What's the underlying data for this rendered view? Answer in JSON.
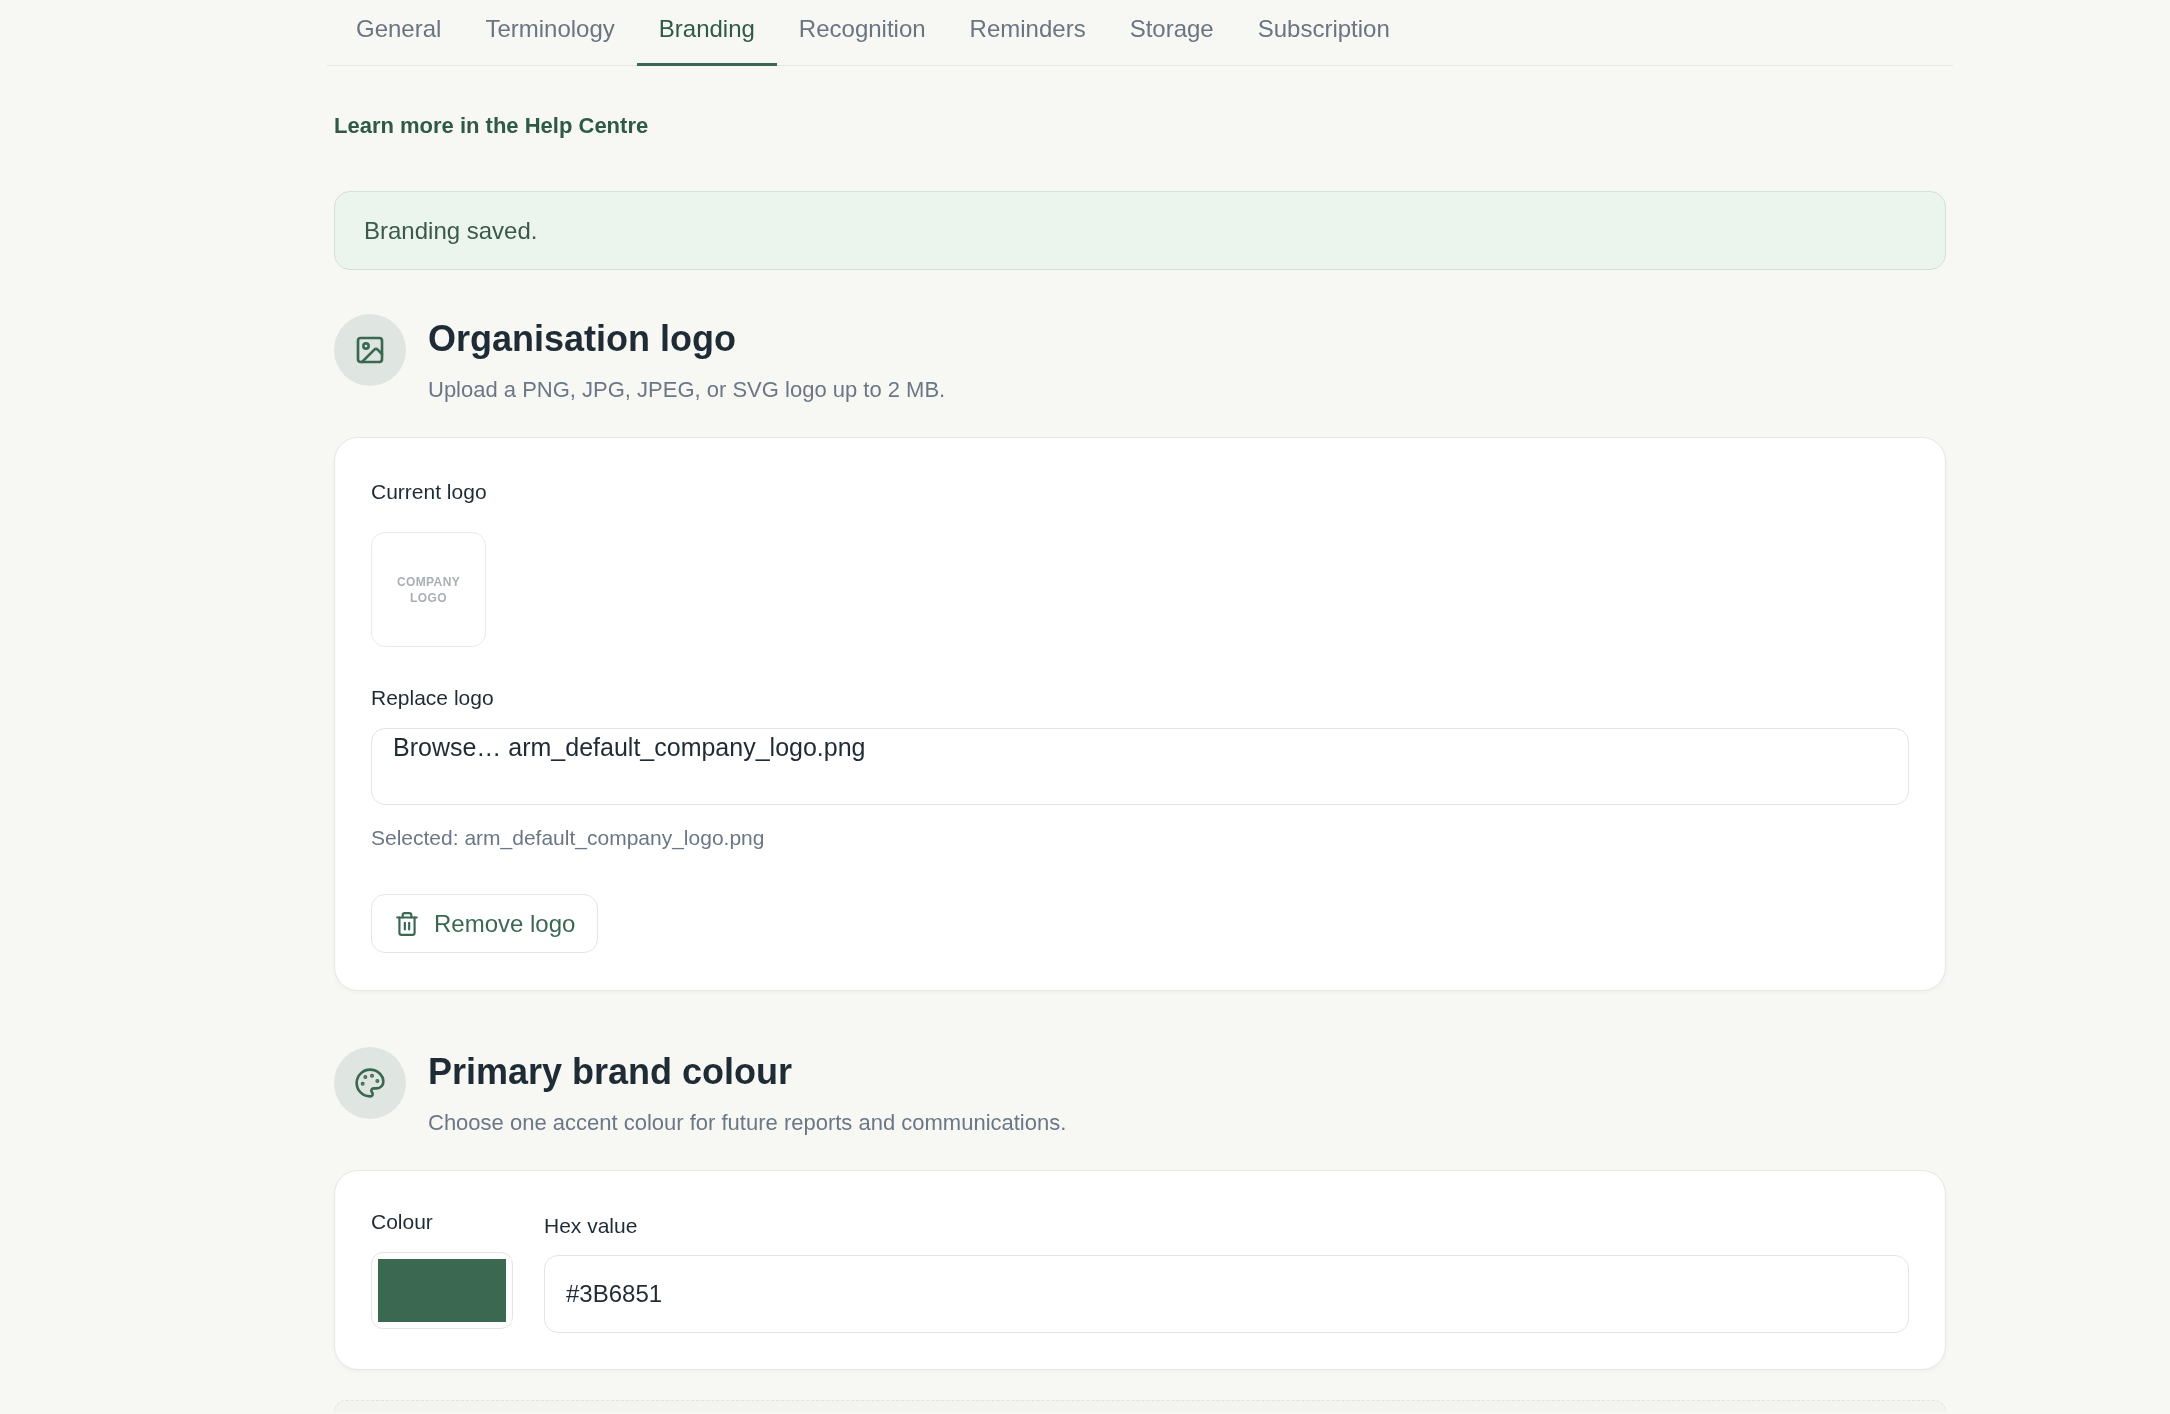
{
  "tabs": [
    {
      "label": "General",
      "selected": false
    },
    {
      "label": "Terminology",
      "selected": false
    },
    {
      "label": "Branding",
      "selected": true
    },
    {
      "label": "Recognition",
      "selected": false
    },
    {
      "label": "Reminders",
      "selected": false
    },
    {
      "label": "Storage",
      "selected": false
    },
    {
      "label": "Subscription",
      "selected": false
    }
  ],
  "help_link": {
    "label": "Learn more in the Help Centre"
  },
  "alert": {
    "message": "Branding saved."
  },
  "sections": [
    {
      "kind": "logo",
      "title": "Organisation logo",
      "subtitle": "Upload a PNG, JPG, JPEG, or SVG logo up to 2 MB.",
      "current_logo": {
        "label": "Current logo",
        "image_text": "COMPANY LOGO"
      },
      "replace_logo": {
        "label": "Replace logo",
        "browse_label": "Browse…",
        "file_name": "arm_default_company_logo.png"
      },
      "selected_note": "Selected: arm_default_company_logo.png",
      "remove_button": {
        "label": "Remove logo"
      }
    },
    {
      "kind": "colour",
      "title": "Primary brand colour",
      "subtitle": "Choose one accent colour for future reports and communications.",
      "colour": {
        "label": "Colour",
        "color": "#3b6851"
      },
      "hex": {
        "label": "Hex value",
        "value": "#3B6851"
      }
    }
  ]
}
